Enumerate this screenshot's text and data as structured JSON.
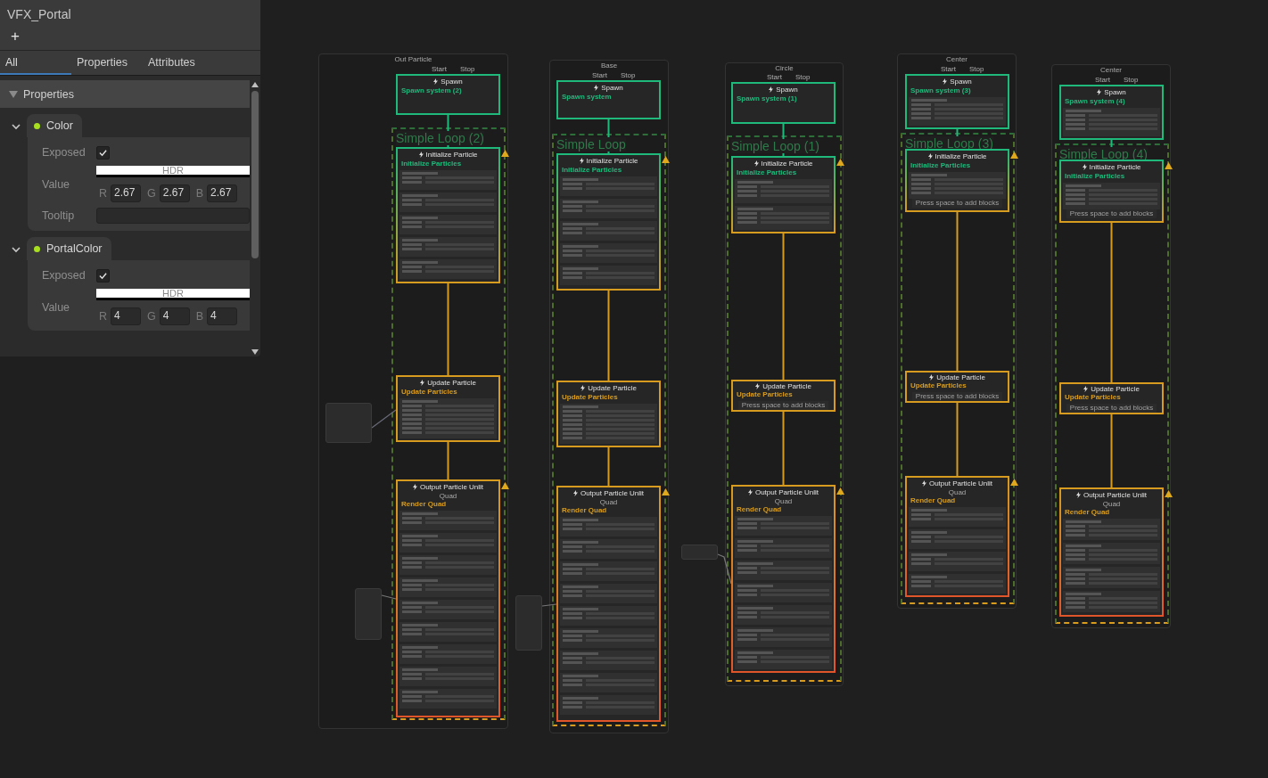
{
  "blackboard": {
    "title": "VFX_Portal",
    "add": "+",
    "tabs": [
      {
        "label": "All",
        "selected": true
      },
      {
        "label": "Properties",
        "selected": false
      },
      {
        "label": "Attributes",
        "selected": false
      }
    ],
    "section": {
      "label": "Properties",
      "expanded": true
    },
    "properties": [
      {
        "name": "Color",
        "expanded": true,
        "fields": [
          {
            "kind": "checkbox",
            "label": "Exposed",
            "checked": true
          },
          {
            "kind": "color",
            "label": "Value",
            "hdr": "HDR",
            "channels": [
              {
                "label": "R",
                "value": "2.67"
              },
              {
                "label": "G",
                "value": "2.67"
              },
              {
                "label": "B",
                "value": "2.67"
              }
            ]
          },
          {
            "kind": "text",
            "label": "Tooltip"
          }
        ]
      },
      {
        "name": "PortalColor",
        "expanded": true,
        "fields": [
          {
            "kind": "checkbox",
            "label": "Exposed",
            "checked": true
          },
          {
            "kind": "color",
            "label": "Value",
            "hdr": "HDR",
            "channels": [
              {
                "label": "R",
                "value": "4"
              },
              {
                "label": "G",
                "value": "4"
              },
              {
                "label": "B",
                "value": "4"
              }
            ]
          }
        ]
      }
    ]
  },
  "graph": {
    "systems": [
      {
        "title": "Out Particle",
        "loop": "Simple Loop (2)",
        "spawn": {
          "ports": [
            "Start",
            "Stop"
          ],
          "title": "Spawn",
          "subtitle": "Spawn system (2)"
        },
        "initialize": {
          "title": "Initialize Particle",
          "subtitle": "Initialize Particles"
        },
        "update": {
          "title": "Update Particle",
          "subtitle": "Update Particles"
        },
        "output": {
          "title": "Output Particle Unlit",
          "type": "Quad",
          "subtitle": "Render Quad"
        }
      },
      {
        "title": "Base",
        "loop": "Simple Loop",
        "spawn": {
          "ports": [
            "Start",
            "Stop"
          ],
          "title": "Spawn",
          "subtitle": "Spawn system"
        },
        "initialize": {
          "title": "Initialize Particle",
          "subtitle": "Initialize Particles"
        },
        "update": {
          "title": "Update Particle",
          "subtitle": "Update Particles"
        },
        "output": {
          "title": "Output Particle Unlit",
          "type": "Quad",
          "subtitle": "Render Quad"
        }
      },
      {
        "title": "Circle",
        "loop": "Simple Loop (1)",
        "spawn": {
          "ports": [
            "Start",
            "Stop"
          ],
          "title": "Spawn",
          "subtitle": "Spawn system (1)"
        },
        "initialize": {
          "title": "Initialize Particle",
          "subtitle": "Initialize Particles"
        },
        "update": {
          "title": "Update Particle",
          "subtitle": "Update Particles",
          "hint": "Press space to add blocks"
        },
        "output": {
          "title": "Output Particle Unlit",
          "type": "Quad",
          "subtitle": "Render Quad"
        }
      },
      {
        "title": "Center",
        "loop": "Simple Loop (3)",
        "spawn": {
          "ports": [
            "Start",
            "Stop"
          ],
          "title": "Spawn",
          "subtitle": "Spawn system (3)"
        },
        "initialize": {
          "title": "Initialize Particle",
          "subtitle": "Initialize Particles",
          "hint": "Press space to add blocks"
        },
        "update": {
          "title": "Update Particle",
          "subtitle": "Update Particles",
          "hint": "Press space to add blocks"
        },
        "output": {
          "title": "Output Particle Unlit",
          "type": "Quad",
          "subtitle": "Render Quad"
        }
      },
      {
        "title": "Center",
        "loop": "Simple Loop (4)",
        "spawn": {
          "ports": [
            "Start",
            "Stop"
          ],
          "title": "Spawn",
          "subtitle": "Spawn system (4)"
        },
        "initialize": {
          "title": "Initialize Particle",
          "subtitle": "Initialize Particles",
          "hint": "Press space to add blocks"
        },
        "update": {
          "title": "Update Particle",
          "subtitle": "Update Particles",
          "hint": "Press space to add blocks"
        },
        "output": {
          "title": "Output Particle Unlit",
          "type": "Quad",
          "subtitle": "Render Quad"
        }
      }
    ]
  }
}
